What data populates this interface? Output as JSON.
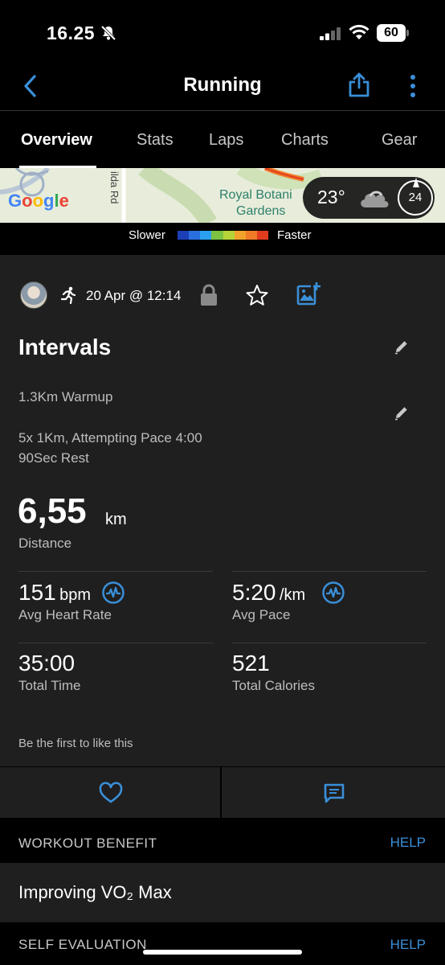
{
  "status": {
    "time": "16.25",
    "battery": "60"
  },
  "nav": {
    "title": "Running"
  },
  "tabs": [
    "Overview",
    "Stats",
    "Laps",
    "Charts",
    "Gear"
  ],
  "map": {
    "google": "Google",
    "road": "ilda Rd",
    "place_line1": "Royal Botani",
    "place_line2": "Gardens",
    "temperature": "23°",
    "wind": "24"
  },
  "legend": {
    "slower": "Slower",
    "faster": "Faster",
    "colors": [
      "#1b3fb5",
      "#2a6fe0",
      "#2aa0ef",
      "#7cc243",
      "#b7d33a",
      "#f1a22a",
      "#f07a26",
      "#e23c1f"
    ]
  },
  "activity": {
    "date": "20 Apr @ 12:14",
    "title": "Intervals",
    "description_line1": "1.3Km Warmup",
    "description_line2": "5x 1Km, Attempting Pace 4:00",
    "description_line3": "90Sec Rest",
    "distance": {
      "value": "6,55",
      "unit": "km",
      "label": "Distance"
    },
    "stats": {
      "heart_rate": {
        "value": "151",
        "unit": "bpm",
        "label": "Avg Heart Rate"
      },
      "pace": {
        "value": "5:20",
        "unit": "/km",
        "label": "Avg Pace"
      },
      "time": {
        "value": "35:00",
        "label": "Total Time"
      },
      "calories": {
        "value": "521",
        "label": "Total Calories"
      }
    },
    "likes": "Be the first to like this"
  },
  "sections": {
    "workout_benefit": {
      "title": "WORKOUT BENEFIT",
      "help": "HELP",
      "value": "Improving VO₂ Max"
    },
    "self_evaluation": {
      "title": "SELF EVALUATION",
      "help": "HELP"
    }
  },
  "accent_color": "#3a8fd8"
}
